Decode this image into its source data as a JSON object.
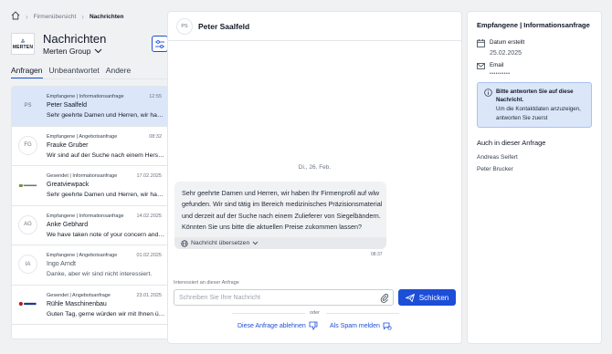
{
  "breadcrumb": {
    "home_icon": "home-icon",
    "parent": "Firmenübersicht",
    "current": "Nachrichten"
  },
  "header": {
    "title": "Nachrichten",
    "company": "Merten Group",
    "logo_text": "MERTEN"
  },
  "tabs": [
    {
      "label": "Anfragen",
      "active": true
    },
    {
      "label": "Unbeantwortet",
      "active": false
    },
    {
      "label": "Andere",
      "active": false
    }
  ],
  "conversations": [
    {
      "avatar": "PS",
      "type": "Empfangene | Informationsanfrage",
      "date": "12:55",
      "name": "Peter Saalfeld",
      "preview": "Sehr geehrte Damen und Herren, wir haben Ihr Firmenprofil auf wlw gefunden.",
      "selected": true
    },
    {
      "avatar": "FG",
      "type": "Empfangene | Angebotsanfrage",
      "date": "08:32",
      "name": "Frauke Gruber",
      "preview": "Wir sind auf der Suche nach einem Hersteller für Siegelbänder."
    },
    {
      "avatar": "logo",
      "type": "Gesendet | Informationsanfrage",
      "date": "17.02.2025",
      "name": "Greatviewpack",
      "preview": "Sehr geehrte Damen und Herren, wir haben Ihr Firmenprofil gefunden."
    },
    {
      "avatar": "AG",
      "type": "Empfangene | Informationsanfrage",
      "date": "14.02.2025",
      "name": "Anke Gebhard",
      "preview": "We have taken note of your concern and suggest a call."
    },
    {
      "avatar": "IA",
      "type": "Empfangene | Angebotsanfrage",
      "date": "01.02.2025",
      "name": "Ingo Arndt",
      "preview": "Danke, aber wir sind nicht interessiert.",
      "muted": true
    },
    {
      "avatar": "logo2",
      "type": "Gesendet | Angebotsanfrage",
      "date": "23.01.2025",
      "name": "Rühle Maschinenbau",
      "preview": "Guten Tag, gerne würden wir mit Ihnen über das Angebot sprechen."
    }
  ],
  "chat": {
    "avatar": "PS",
    "name": "Peter Saalfeld",
    "date_separator": "Di., 26. Feb.",
    "message": "Sehr geehrte Damen und Herren, wir haben Ihr Firmenprofil auf wlw gefunden. Wir sind tätig im Bereich medizinisches Präzisionsmaterial und derzeit auf der Suche nach einem Zulieferer von Siegelbändern. Könnten Sie uns bitte die aktuellen Preise zukommen lassen?",
    "translate_label": "Nachricht übersetzen",
    "time": "08:37",
    "context_label": "Interessiert an dieser Anfrage",
    "input_placeholder": "Schreiben Sie Ihre Nachricht",
    "send_label": "Schicken",
    "or_label": "oder",
    "decline_label": "Diese Anfrage ablehnen",
    "spam_label": "Als Spam melden"
  },
  "details": {
    "title": "Empfangene | Informationsanfrage",
    "created_label": "Datum erstellt",
    "created_value": "25.02.2025",
    "email_label": "Email",
    "email_value": "••••••••••",
    "info_bold": "Bitte antworten Sie auf diese Nachricht.",
    "info_text": "Um die Kontaktdaten anzuzeigen, antworten Sie zuerst",
    "participants_title": "Auch in dieser Anfrage",
    "participants": [
      "Andreas Seifert",
      "Peter Brucker"
    ]
  },
  "colors": {
    "accent": "#1d4ed8",
    "selected_bg": "#dbe7f8",
    "page_bg": "#f0f1f3"
  }
}
